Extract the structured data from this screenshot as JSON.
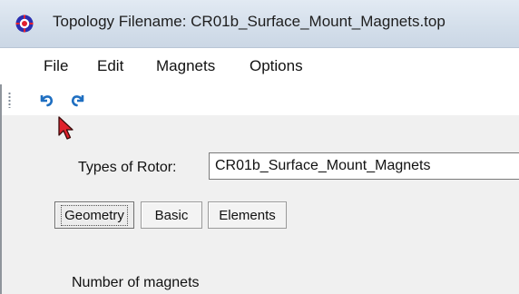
{
  "window": {
    "title": "Topology Filename: CR01b_Surface_Mount_Magnets.top",
    "app_icon": "app-logo-icon"
  },
  "menubar": {
    "items": [
      {
        "label": "File"
      },
      {
        "label": "Edit"
      },
      {
        "label": "Magnets"
      },
      {
        "label": "Options"
      }
    ]
  },
  "toolbar": {
    "buttons": [
      {
        "icon": "undo-icon"
      },
      {
        "icon": "redo-icon"
      }
    ]
  },
  "form": {
    "rotor_label": "Types of Rotor:",
    "rotor_value": "CR01b_Surface_Mount_Magnets",
    "tabs": [
      {
        "label": "Geometry",
        "active": true
      },
      {
        "label": "Basic",
        "active": false
      },
      {
        "label": "Elements",
        "active": false
      }
    ],
    "magnets_label": "Number of magnets"
  },
  "colors": {
    "toolbar_icon": "#1f6fc1",
    "cursor": "#e0212b"
  }
}
